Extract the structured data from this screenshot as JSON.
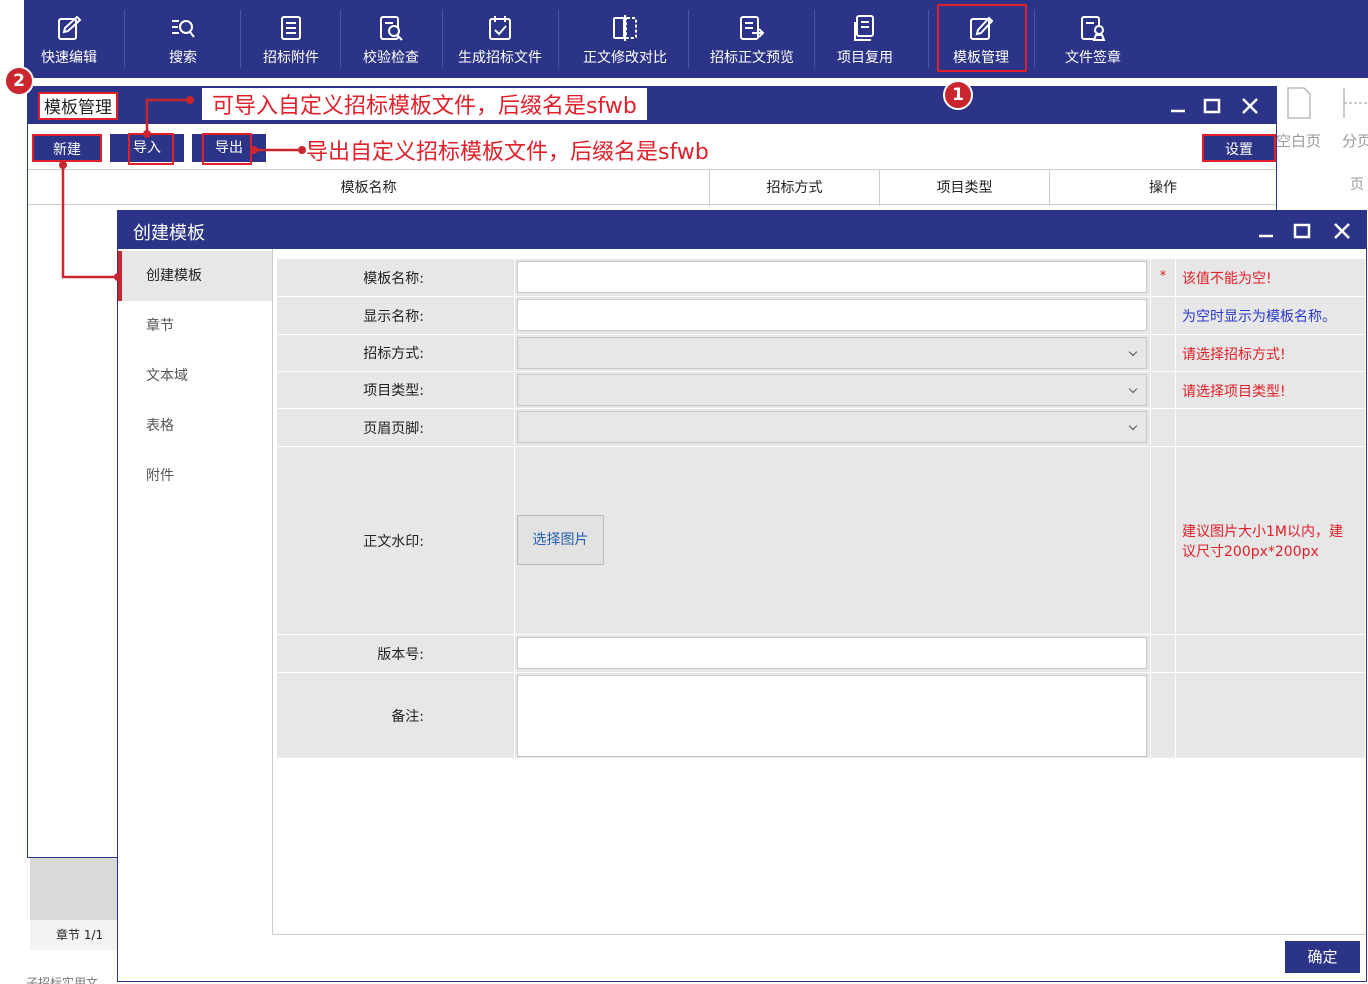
{
  "toolbar": {
    "items": [
      {
        "label": "快速编辑",
        "icon": "quick-edit-icon"
      },
      {
        "label": "搜索",
        "icon": "search-icon"
      },
      {
        "label": "招标附件",
        "icon": "attachment-icon"
      },
      {
        "label": "校验检查",
        "icon": "check-icon"
      },
      {
        "label": "生成招标文件",
        "icon": "generate-icon"
      },
      {
        "label": "正文修改对比",
        "icon": "compare-icon"
      },
      {
        "label": "招标正文预览",
        "icon": "preview-icon"
      },
      {
        "label": "项目复用",
        "icon": "reuse-icon"
      },
      {
        "label": "模板管理",
        "icon": "template-icon"
      },
      {
        "label": "文件签章",
        "icon": "seal-icon"
      }
    ]
  },
  "right_panel": {
    "blank_page": "空白页",
    "page_break": "分页",
    "page": "页"
  },
  "manager": {
    "title": "模板管理",
    "buttons": {
      "new": "新建",
      "import": "导入",
      "export": "导出",
      "settings": "设置"
    },
    "columns": [
      "模板名称",
      "招标方式",
      "项目类型",
      "操作"
    ],
    "status": "章节 1/1"
  },
  "annotations": {
    "import_note": "可导入自定义招标模板文件，后缀名是sfwb",
    "export_note": "导出自定义招标模板文件，后缀名是sfwb",
    "badge_1": "1",
    "badge_2": "2"
  },
  "dialog": {
    "title": "创建模板",
    "sidebar": [
      "创建模板",
      "章节",
      "文本域",
      "表格",
      "附件"
    ],
    "form": {
      "template_name": {
        "label": "模板名称:",
        "value": "",
        "required_mark": "*",
        "hint": "该值不能为空!"
      },
      "display_name": {
        "label": "显示名称:",
        "value": "",
        "hint": "为空时显示为模板名称。"
      },
      "bid_method": {
        "label": "招标方式:",
        "value": "",
        "hint": "请选择招标方式!"
      },
      "project_type": {
        "label": "项目类型:",
        "value": "",
        "hint": "请选择项目类型!"
      },
      "header_footer": {
        "label": "页眉页脚:",
        "value": ""
      },
      "watermark": {
        "label": "正文水印:",
        "button": "选择图片",
        "hint_line1": "建议图片大小1M以内，建",
        "hint_line2": "议尺寸200px*200px"
      },
      "version": {
        "label": "版本号:",
        "value": ""
      },
      "remark": {
        "label": "备注:",
        "value": ""
      }
    },
    "confirm": "确定"
  },
  "footer_cut_text": "子招标实用文"
}
